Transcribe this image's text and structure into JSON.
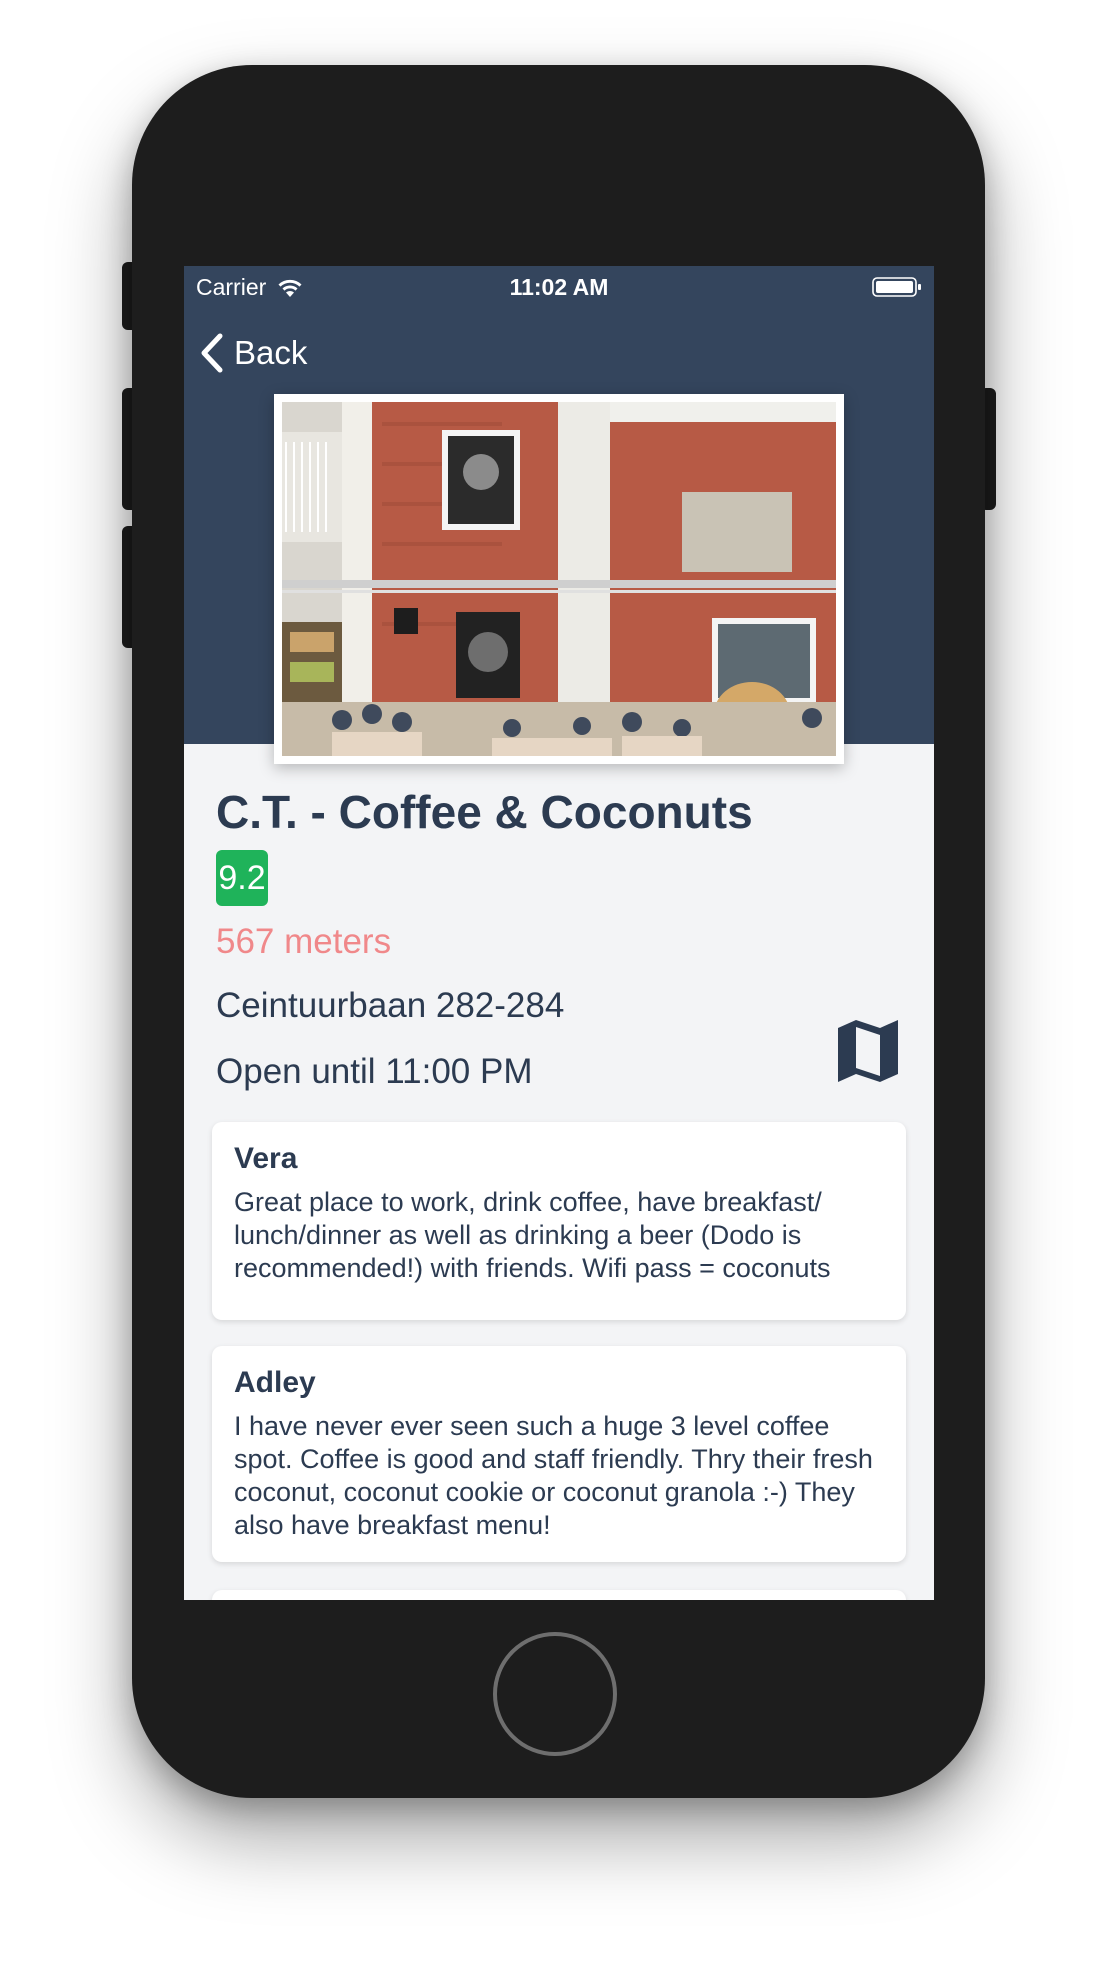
{
  "status_bar": {
    "carrier": "Carrier",
    "time": "11:02 AM"
  },
  "nav": {
    "back_label": "Back"
  },
  "venue": {
    "name": "C.T. - Coffee & Coconuts",
    "rating": "9.2",
    "distance": "567 meters",
    "address": "Ceintuurbaan 282-284",
    "hours": "Open until 11:00 PM",
    "photo_icon": "cafe-photo",
    "map_icon": "map-icon"
  },
  "reviews": [
    {
      "author": "Vera",
      "text": "Great place to work, drink coffee, have breakfast/ lunch/dinner as well as drinking a beer (Dodo is recommended!) with friends. Wifi pass = coconuts"
    },
    {
      "author": "Adley",
      "text": "I have never ever seen such a huge 3 level coffee spot. Coffee is good and staff friendly. Thry their fresh coconut, coconut cookie or coconut granola :-) They also have breakfast menu!"
    }
  ],
  "colors": {
    "header": "#34455d",
    "background": "#f3f4f6",
    "text": "#2c3b51",
    "rating_badge": "#1fb35a",
    "distance": "#f0888a"
  }
}
